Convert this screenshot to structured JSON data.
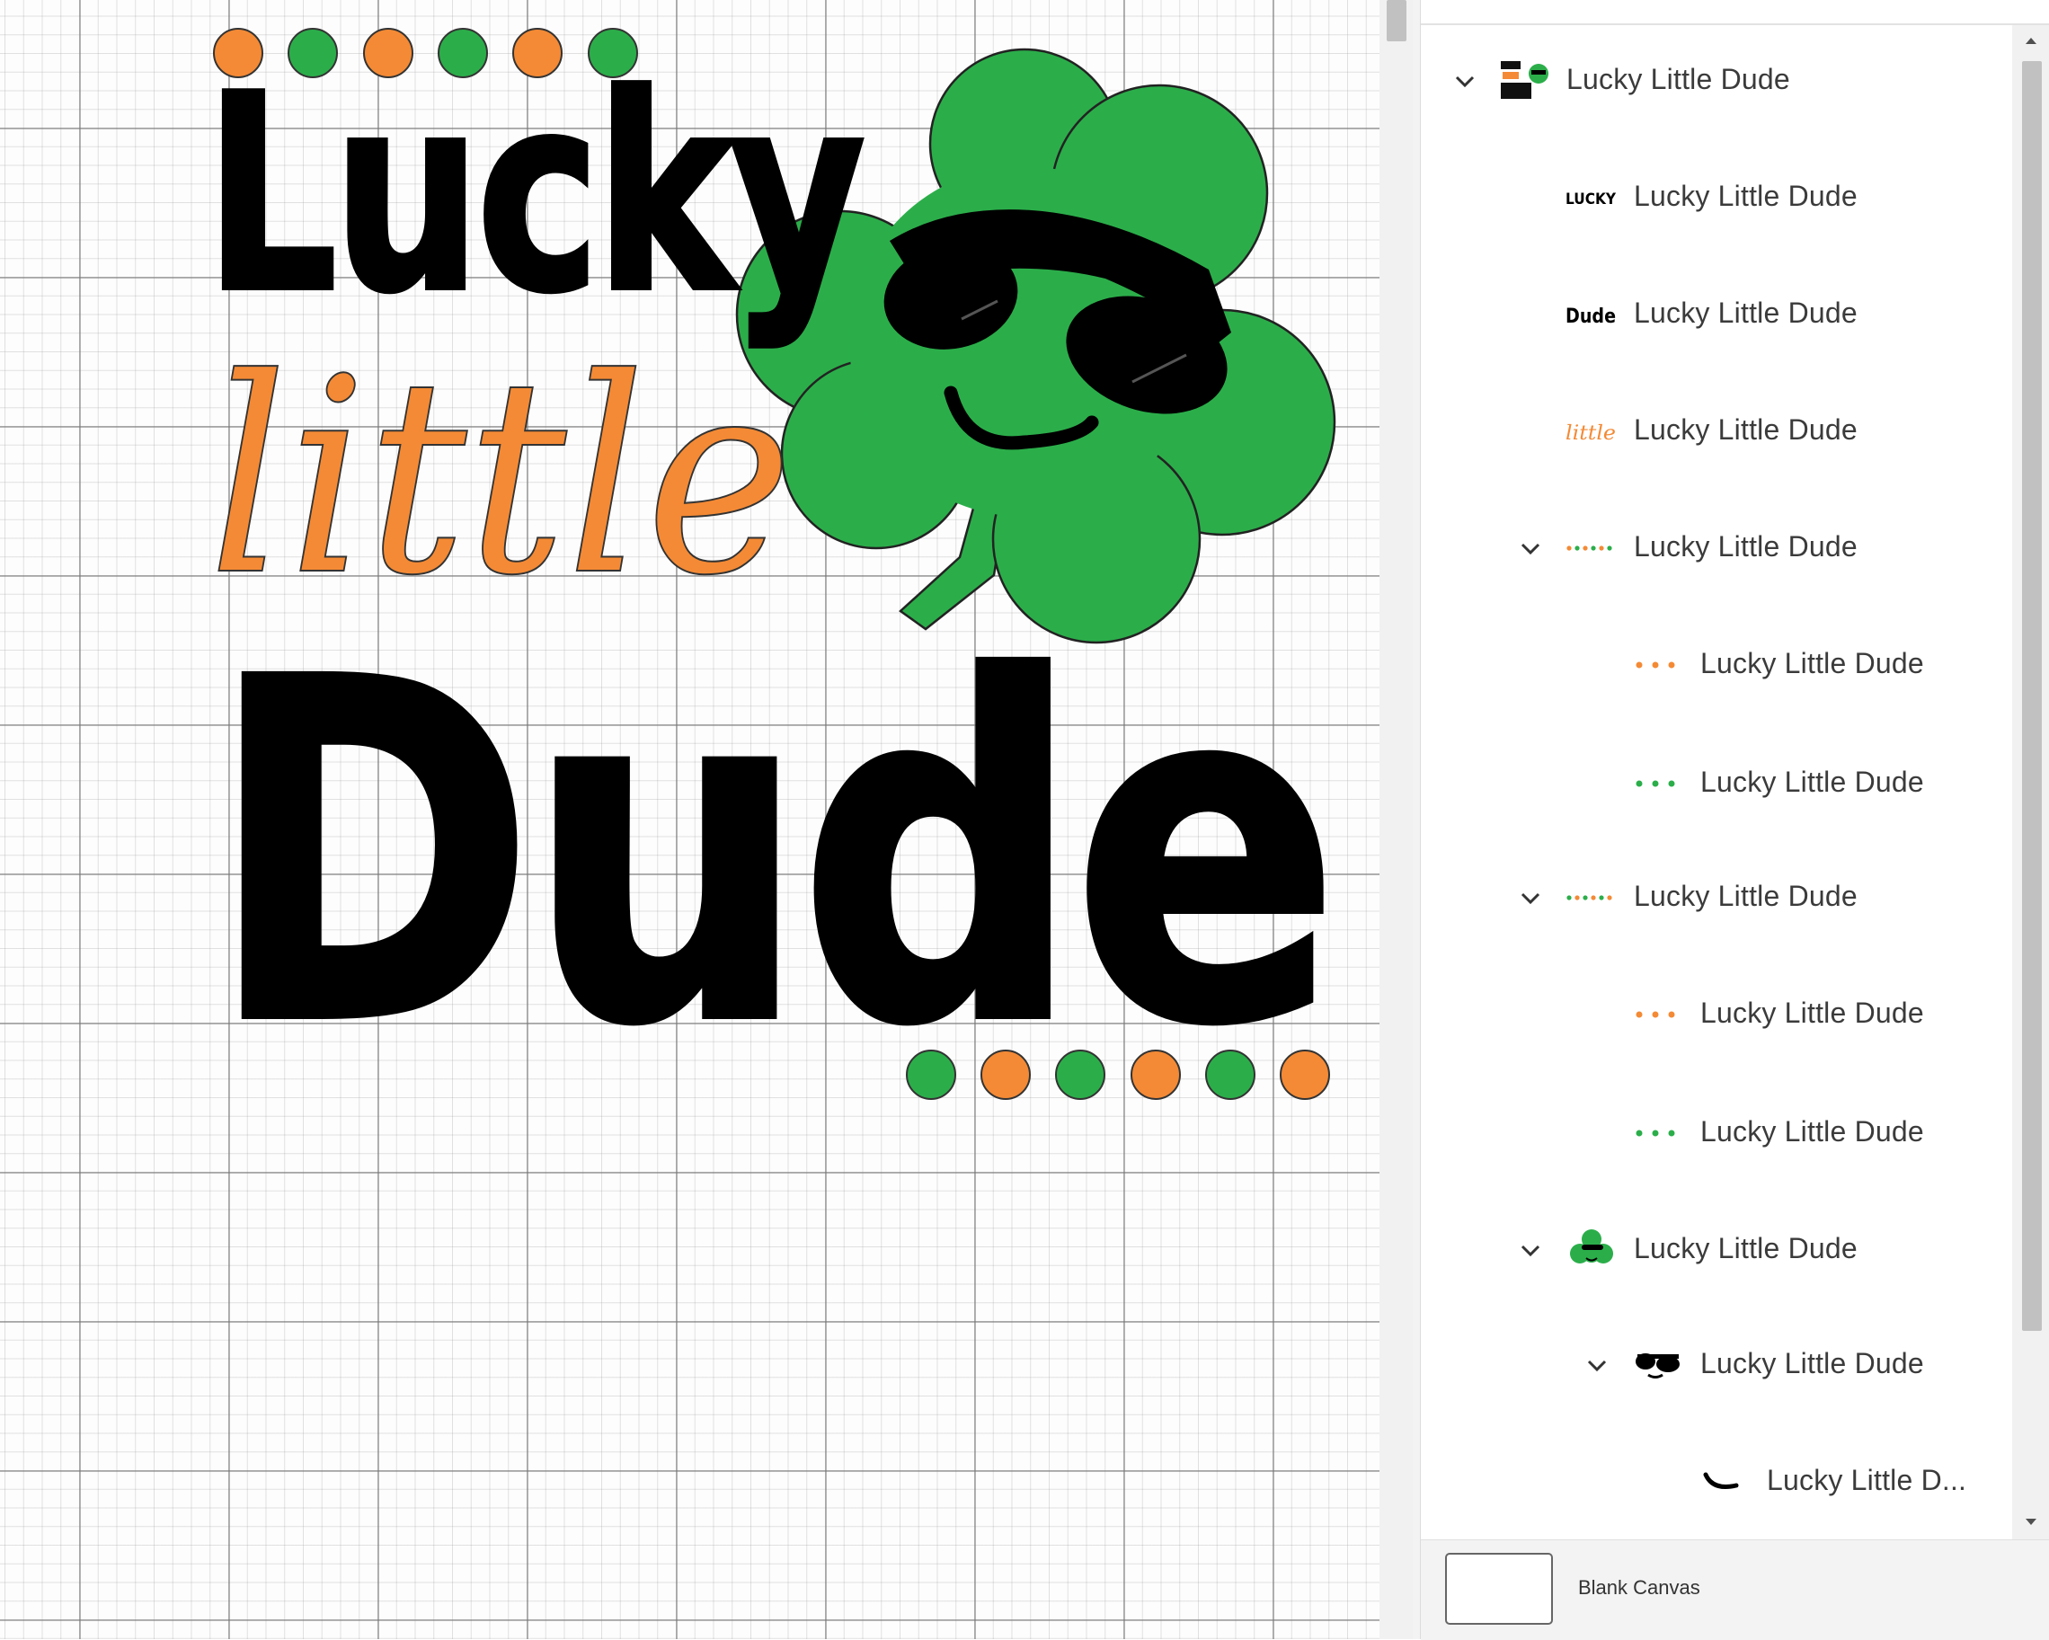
{
  "design": {
    "words": [
      "Lucky",
      "little",
      "Dude"
    ],
    "colors": {
      "orange": "#F48A35",
      "green": "#2BAE4A",
      "black": "#000000",
      "outline": "#333333"
    },
    "dot_sequence_top": [
      "orange",
      "green",
      "orange",
      "green",
      "orange",
      "green"
    ],
    "dot_sequence_bottom": [
      "green",
      "orange",
      "green",
      "orange",
      "green",
      "orange"
    ]
  },
  "layers_panel": {
    "rows": [
      {
        "label": "Lucky Little Dude",
        "thumb": "full-design-icon",
        "expanded": true
      },
      {
        "label": "Lucky Little Dude",
        "thumb": "lucky-text-icon"
      },
      {
        "label": "Lucky Little Dude",
        "thumb": "dude-text-icon"
      },
      {
        "label": "Lucky Little Dude",
        "thumb": "little-text-icon"
      },
      {
        "label": "Lucky Little Dude",
        "thumb": "dot-row-icon",
        "expanded": true
      },
      {
        "label": "Lucky Little Dude",
        "thumb": "orange-dots-icon"
      },
      {
        "label": "Lucky Little Dude",
        "thumb": "green-dots-icon"
      },
      {
        "label": "Lucky Little Dude",
        "thumb": "dot-row-icon",
        "expanded": true
      },
      {
        "label": "Lucky Little Dude",
        "thumb": "orange-dots-icon"
      },
      {
        "label": "Lucky Little Dude",
        "thumb": "green-dots-icon"
      },
      {
        "label": "Lucky Little Dude",
        "thumb": "shamrock-icon",
        "expanded": true
      },
      {
        "label": "Lucky Little Dude",
        "thumb": "sunglasses-icon",
        "expanded": true
      },
      {
        "label": "Lucky Little D...",
        "thumb": "smile-icon"
      }
    ],
    "footer": {
      "label": "Blank Canvas"
    }
  }
}
